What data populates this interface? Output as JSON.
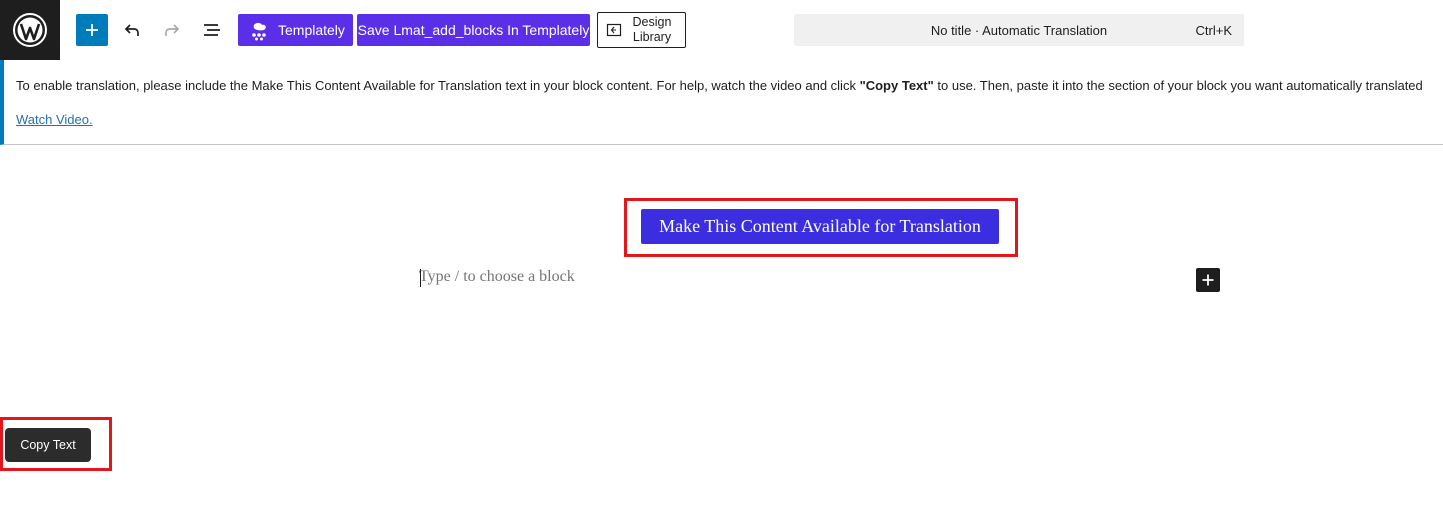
{
  "toolbar": {
    "templately_label": "Templately",
    "save_label": "Save Lmat_add_blocks In Templately",
    "design_library_label_line1": "Design",
    "design_library_label_line2": "Library",
    "command_title": "No title · Automatic Translation",
    "command_shortcut": "Ctrl+K"
  },
  "notice": {
    "text_before": "To enable translation, please include the Make This Content Available for Translation text in your block content. For help, watch the video and click ",
    "text_bold": "\"Copy Text\"",
    "text_after": " to use. Then, paste it into the section of your block you want automatically translated",
    "link": "Watch Video."
  },
  "canvas": {
    "translate_button": "Make This Content Available for Translation",
    "placeholder": "Type / to choose a block"
  },
  "copy_button": "Copy Text",
  "colors": {
    "wp_dark": "#1e1e1e",
    "wp_blue": "#007cba",
    "templately_purple": "#5b2ee8",
    "translate_button": "#3b2ee0",
    "highlight_red": "#e4161b",
    "link": "#2271b1"
  },
  "icons": [
    "wordpress-logo-icon",
    "plus-icon",
    "undo-icon",
    "redo-icon",
    "document-overview-icon",
    "templately-icon",
    "design-library-icon",
    "plus-icon"
  ]
}
